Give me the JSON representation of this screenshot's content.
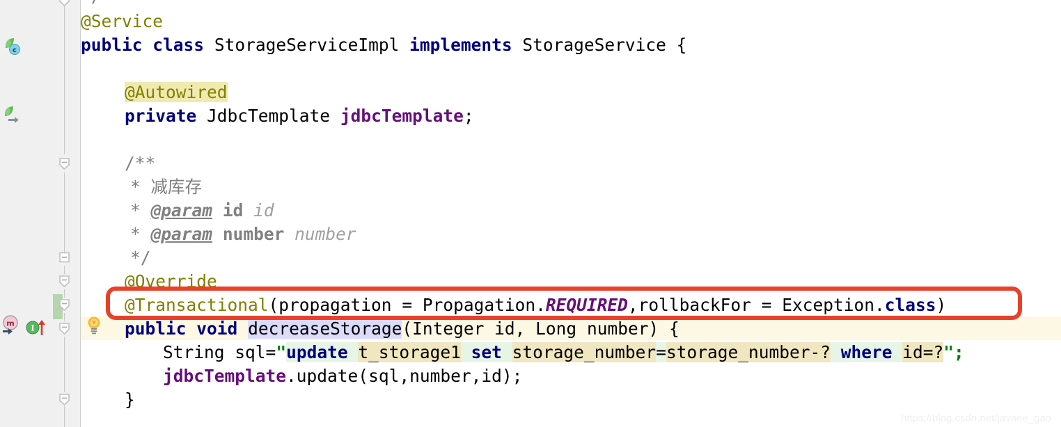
{
  "editor": {
    "app": "IntelliJ IDEA Java Editor",
    "file_language": "Java",
    "watermark": "https://blog.csdn.net/javaee_gao"
  },
  "annotation": {
    "shape": "rounded-rectangle",
    "color": "#e8402a",
    "target_line": "@Transactional(propagation = Propagation.REQUIRED,rollbackFor = Exception.class)"
  },
  "gutter": {
    "icons": [
      {
        "name": "spring-bean-class-icon",
        "badge": "c",
        "line": 2,
        "tooltip": "Spring Bean class"
      },
      {
        "name": "spring-bean-navigate-icon",
        "badge": "arrow",
        "line": 5,
        "tooltip": "Navigate to Spring bean"
      },
      {
        "name": "overridden-method-icon",
        "badge": "m",
        "line": 14,
        "tooltip": "Overrides method"
      },
      {
        "name": "implementing-method-icon",
        "badge": "I",
        "line": 14,
        "tooltip": "Implements method in StorageService"
      },
      {
        "name": "intention-bulb-icon",
        "badge": "bulb",
        "line": 14,
        "tooltip": "Show intention actions"
      }
    ],
    "fold_markers": [
      6,
      11,
      12,
      13,
      14,
      17
    ],
    "vcs_change": {
      "type": "modified",
      "color": "#b4d6ac",
      "lines": [
        13
      ]
    }
  },
  "code": {
    "lines": [
      {
        "n": 0,
        "text": "    */",
        "clipped": true
      },
      {
        "n": 1,
        "text": "@Service"
      },
      {
        "n": 2,
        "text": "public class StorageServiceImpl implements StorageService {"
      },
      {
        "n": 3,
        "text": ""
      },
      {
        "n": 4,
        "text": "    @Autowired"
      },
      {
        "n": 5,
        "text": "    private JdbcTemplate jdbcTemplate;"
      },
      {
        "n": 6,
        "text": ""
      },
      {
        "n": 7,
        "text": "    /**"
      },
      {
        "n": 8,
        "text": "     * 减库存"
      },
      {
        "n": 9,
        "text": "     * @param id id"
      },
      {
        "n": 10,
        "text": "     * @param number number"
      },
      {
        "n": 11,
        "text": "     */"
      },
      {
        "n": 12,
        "text": "    @Override"
      },
      {
        "n": 13,
        "text": "    @Transactional(propagation = Propagation.REQUIRED,rollbackFor = Exception.class)"
      },
      {
        "n": 14,
        "text": "    public void decreaseStorage(Integer id, Long number) {",
        "current": true
      },
      {
        "n": 15,
        "text": "        String sql=\"update t_storage1 set storage_number=storage_number-? where id=?\";"
      },
      {
        "n": 16,
        "text": "        jdbcTemplate.update(sql,number,id);"
      },
      {
        "n": 17,
        "text": "    }"
      }
    ],
    "tokens": {
      "service_anno": "@Service",
      "kw_public": "public",
      "kw_class": "class",
      "type_impl": "StorageServiceImpl",
      "kw_implements": "implements",
      "type_iface": "StorageService",
      "brace_open": "{",
      "autowired_anno": "@Autowired",
      "kw_private": "private",
      "type_jdbc": "JdbcTemplate",
      "field_jdbc": "jdbcTemplate",
      "semi": ";",
      "doc_open": "/**",
      "doc_star": "*",
      "doc_summary": "减库存",
      "doc_param_tag": "@param",
      "doc_param_id": "id",
      "doc_param_id_desc": "id",
      "doc_param_number": "number",
      "doc_param_number_desc": "number",
      "doc_close": "*/",
      "override_anno": "@Override",
      "transactional_anno": "@Transactional",
      "propagation_key": "propagation",
      "eq": "=",
      "propagation_type": "Propagation",
      "dot": ".",
      "required_const": "REQUIRED",
      "comma": ",",
      "rollback_key": "rollbackFor",
      "exception_type": "Exception",
      "kw_class_literal": "class",
      "paren_open": "(",
      "paren_close": ")",
      "kw_void": "void",
      "method_name": "decreaseStorage",
      "param_type_integer": "Integer",
      "param_id": "id",
      "param_type_long": "Long",
      "param_number": "number",
      "type_string": "String",
      "var_sql": "sql",
      "quote": "\"",
      "sql_update": "update",
      "sql_table": "t_storage1",
      "sql_set": "set",
      "sql_col_a": "storage_number",
      "sql_eq": "=",
      "sql_col_b": "storage_number-?",
      "sql_where": "where",
      "sql_id_pred": "id=?",
      "call_update": "update",
      "arg_sql": "sql",
      "arg_number": "number",
      "arg_id": "id",
      "brace_close": "}"
    }
  }
}
